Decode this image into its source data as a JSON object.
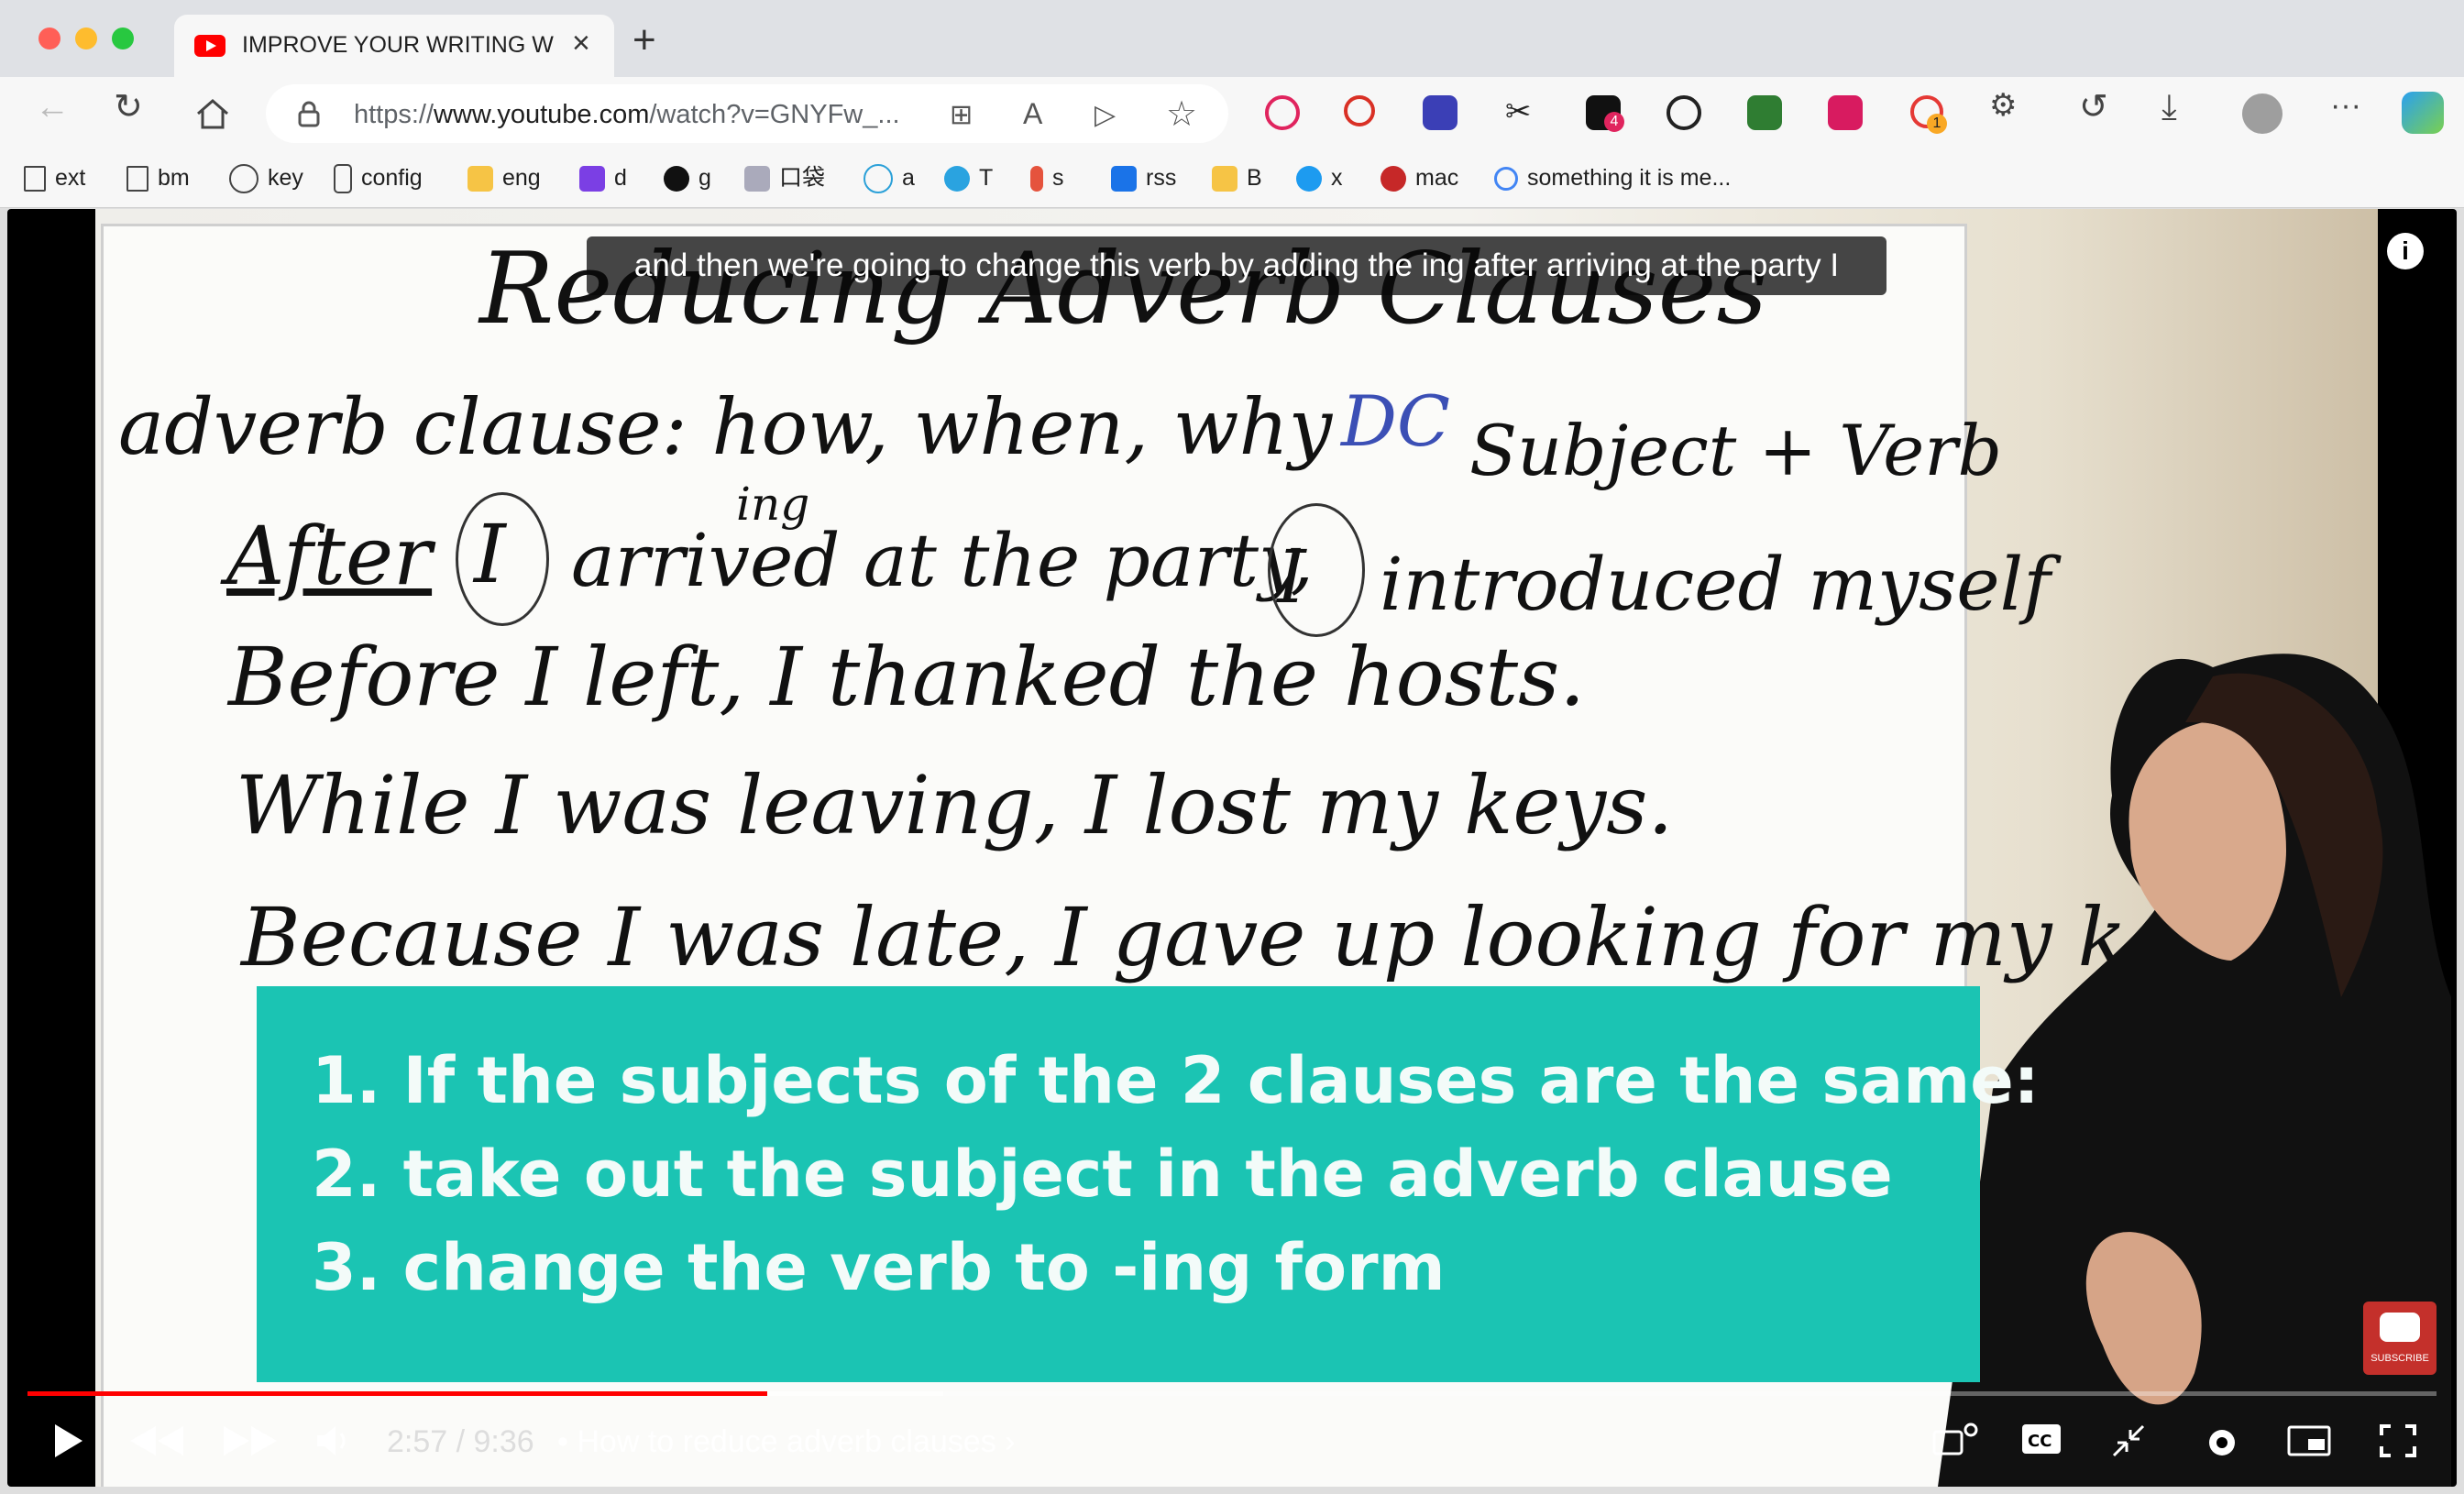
{
  "browser": {
    "tab_title": "IMPROVE YOUR WRITING WITH",
    "url_prefix": "https://",
    "url_domain": "www.youtube.com",
    "url_path": "/watch?v=GNYFw_...",
    "tab_close": "×",
    "new_tab": "+",
    "notifications": {
      "extension_badge": "4",
      "record_badge": "1"
    }
  },
  "bookmarks": [
    {
      "label": "ext",
      "icon": "page-icon"
    },
    {
      "label": "bm",
      "icon": "page-icon"
    },
    {
      "label": "key",
      "icon": "puzzle-icon"
    },
    {
      "label": "config",
      "icon": "flask-icon"
    },
    {
      "label": "eng",
      "icon": "folder-icon"
    },
    {
      "label": "d",
      "icon": "purple-app-icon"
    },
    {
      "label": "g",
      "icon": "github-icon"
    },
    {
      "label": "口袋",
      "icon": "pocket-icon"
    },
    {
      "label": "a",
      "icon": "star-outline-icon"
    },
    {
      "label": "T",
      "icon": "telegram-icon"
    },
    {
      "label": "s",
      "icon": "mic-icon"
    },
    {
      "label": "rss",
      "icon": "rss-icon"
    },
    {
      "label": "B",
      "icon": "folder-icon"
    },
    {
      "label": "x",
      "icon": "twitter-icon"
    },
    {
      "label": "mac",
      "icon": "apple-icon"
    },
    {
      "label": "something it is me...",
      "icon": "google-icon"
    }
  ],
  "video": {
    "caption": "and then we're going to change this verb by  adding the ing after arriving at the party I",
    "board": {
      "title": "Reducing Adverb Clauses",
      "line1": "adverb clause: how, when, why",
      "dc": "DC",
      "sv": "Subject + Verb",
      "ing": "ing",
      "line2a": "After",
      "line2b": "I",
      "line2c": "arrived at the party,",
      "line2d": "I",
      "line2e": "introduced myself",
      "line3": "Before I left, I thanked the hosts.",
      "line4": "While I was leaving, I lost my keys.",
      "line5": "Because I was late, I gave up looking for my k"
    },
    "overlay": [
      "1. If the subjects of the 2 clauses are the same:",
      "2. take out the subject in the adverb clause",
      "3. change the verb to -ing form"
    ],
    "subscribe": "SUBSCRIBE",
    "time_current": "2:57",
    "time_total": "9:36",
    "time_display": "2:57 / 9:36",
    "chapter": "How to reduce adverb clauses",
    "progress": 0.307,
    "buffered": 0.38
  },
  "colors": {
    "accent": "#ff0000",
    "overlay": "#1bc4b3"
  }
}
